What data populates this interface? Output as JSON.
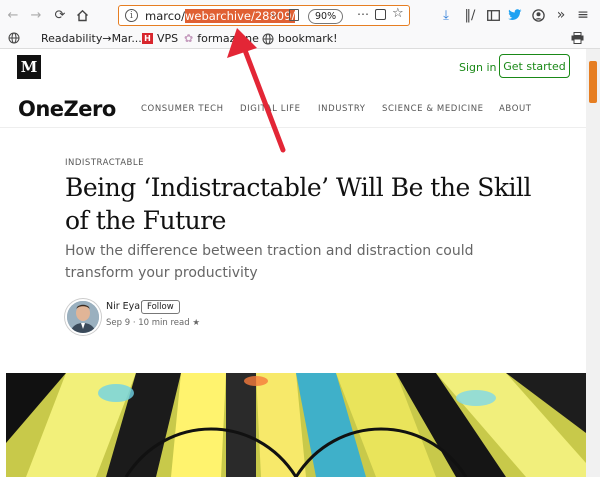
{
  "browser": {
    "url_prefix": "marco/",
    "url_selected": "webarchive/28809/",
    "zoom": "90%",
    "bookmarks": [
      {
        "label": "Readability→Mar..."
      },
      {
        "label": "VPS"
      },
      {
        "label": "formazione"
      },
      {
        "label": "bookmark!"
      }
    ]
  },
  "header": {
    "signin_label": "Sign in",
    "getstarted_label": "Get started"
  },
  "publication": {
    "name": "OneZero",
    "nav": [
      "CONSUMER TECH",
      "DIGITAL LIFE",
      "INDUSTRY",
      "SCIENCE & MEDICINE",
      "ABOUT"
    ]
  },
  "article": {
    "kicker": "INDISTRACTABLE",
    "title": "Being ‘Indistractable’ Will Be the Skill of the Future",
    "subtitle": "How the difference between traction and distraction could transform your productivity",
    "author": "Nir Eyal",
    "follow_label": "Follow",
    "meta": "Sep 9 · 10 min read ★"
  },
  "colors": {
    "accent": "#1a8917",
    "annotation": "#e32636",
    "url_highlight": "#e06033"
  }
}
